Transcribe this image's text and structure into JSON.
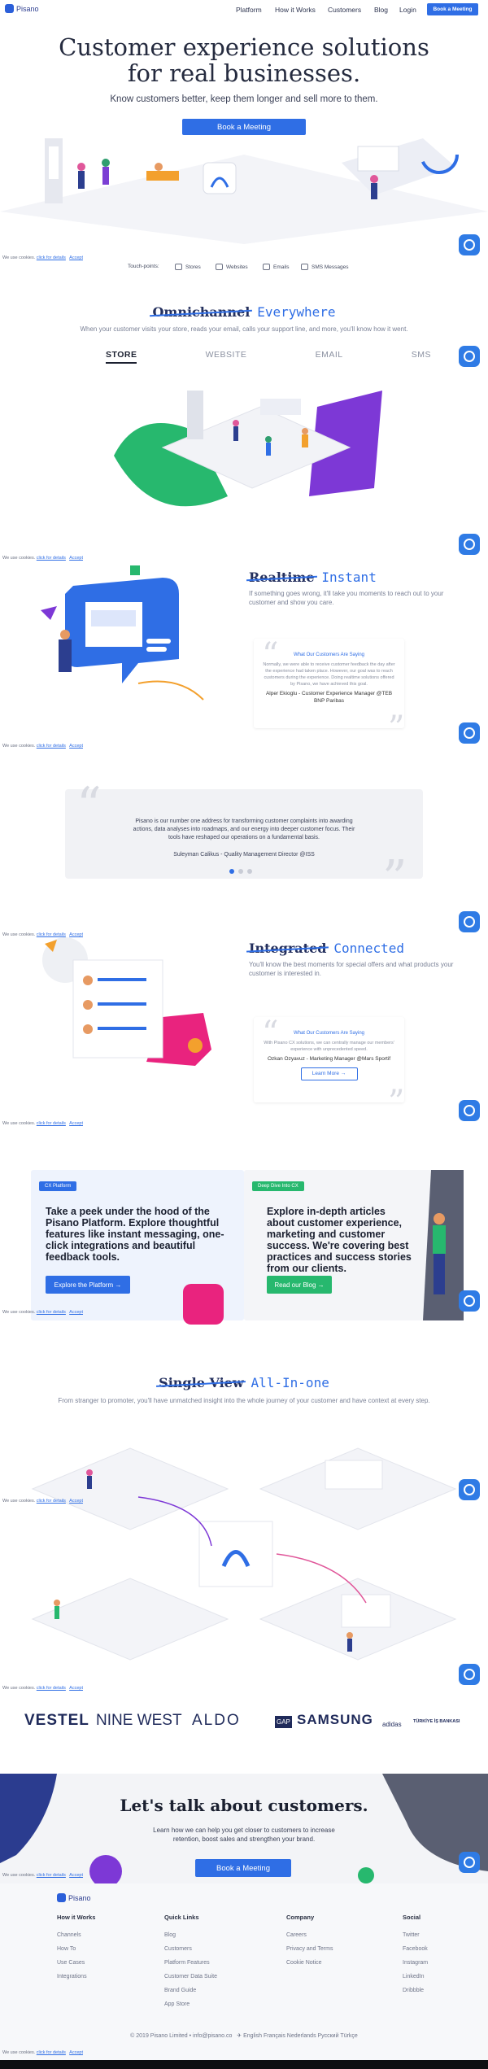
{
  "nav": {
    "logo": "Pisano",
    "items": [
      "Platform",
      "How it Works",
      "Customers",
      "Blog",
      "Login"
    ],
    "cta": "Book a Meeting"
  },
  "hero": {
    "title1": "Customer experience solutions",
    "title2": "for real businesses.",
    "subtitle": "Know customers better, keep them longer and sell more to them.",
    "button": "Book a Meeting"
  },
  "cookie": {
    "text": "We use cookies.",
    "link": "click for details",
    "accept": "Accept"
  },
  "touchpoints": {
    "label": "Touch-points:",
    "items": [
      "Stores",
      "Websites",
      "Emails",
      "SMS Messages"
    ]
  },
  "omni": {
    "strike": "Omnichannel",
    "hand": "Everywhere",
    "text": "When your customer visits your store, reads your email, calls your support line, and more, you'll know how it went.",
    "tabs": [
      "STORE",
      "WEBSITE",
      "EMAIL",
      "SMS"
    ]
  },
  "realtime": {
    "strike": "Realtime",
    "hand": "Instant",
    "text": "If something goes wrong, it'll take you moments to reach out to your customer and show you care.",
    "quote_head": "What Our Customers Are Saying",
    "quote": "Normally, we were able to receive customer feedback the day after the experience had taken place. However, our goal was to reach customers during the experience. Doing realtime solutions offered by Pisano, we have achieved this goal.",
    "author": "Alper Ekioglu - Customer Experience Manager @TEB BNP Paribas"
  },
  "testimonial": {
    "text": "Pisano is our number one address for transforming customer complaints into awarding actions, data analyses into roadmaps, and our energy into deeper customer focus. Their tools have reshaped our operations on a fundamental basis.",
    "author": "Suleyman Calikus - Quality Management Director @ISS"
  },
  "connected": {
    "strike": "Integrated",
    "hand": "Connected",
    "text": "You'll know the best moments for special offers and what products your customer is interested in.",
    "quote_head": "What Our Customers Are Saying",
    "quote": "With Pisano CX solutions, we can centrally manage our members' experience with unprecedented speed.",
    "author": "Ozkan Ozyavuz - Marketing Manager @Mars Sportif",
    "button": "Learn More →"
  },
  "cards": {
    "left": {
      "pill": "CX Platform",
      "title": "Take a peek under the hood of the Pisano Platform. Explore thoughtful features like instant messaging, one-click integrations and beautiful feedback tools.",
      "button": "Explore the Platform →"
    },
    "right": {
      "pill": "Deep Dive Into CX",
      "title": "Explore in-depth articles about customer experience, marketing and customer success. We're covering best practices and success stories from our clients.",
      "button": "Read our Blog →"
    }
  },
  "single": {
    "strike": "Single View",
    "hand": "All-In-one",
    "text": "From stranger to promoter, you'll have unmatched insight into the whole journey of your customer and have context at every step."
  },
  "brands": [
    "VESTEL",
    "NINE WEST",
    "ALDO",
    "GAP",
    "SAMSUNG",
    "adidas",
    "TÜRKİYE İŞ BANKASI"
  ],
  "talk": {
    "title": "Let's talk about customers.",
    "text": "Learn how we can help you get closer to customers to increase retention, boost sales and strengthen your brand.",
    "button": "Book a Meeting"
  },
  "footer": {
    "logo": "Pisano",
    "cols": [
      {
        "title": "How it Works",
        "items": [
          "Channels",
          "How To",
          "Use Cases",
          "Integrations"
        ]
      },
      {
        "title": "Quick Links",
        "items": [
          "Blog",
          "Customers",
          "Platform Features",
          "Customer Data Suite",
          "Brand Guide",
          "App Store"
        ]
      },
      {
        "title": "Company",
        "items": [
          "Careers",
          "Privacy and Terms",
          "Cookie Notice"
        ]
      },
      {
        "title": "Social",
        "items": [
          "Twitter",
          "Facebook",
          "Instagram",
          "LinkedIn",
          "Dribbble"
        ]
      }
    ],
    "copyright": "© 2019 Pisano Limited • info@pisano.co",
    "langs": "English  Français  Nederlands  Русский  Türkçe"
  }
}
